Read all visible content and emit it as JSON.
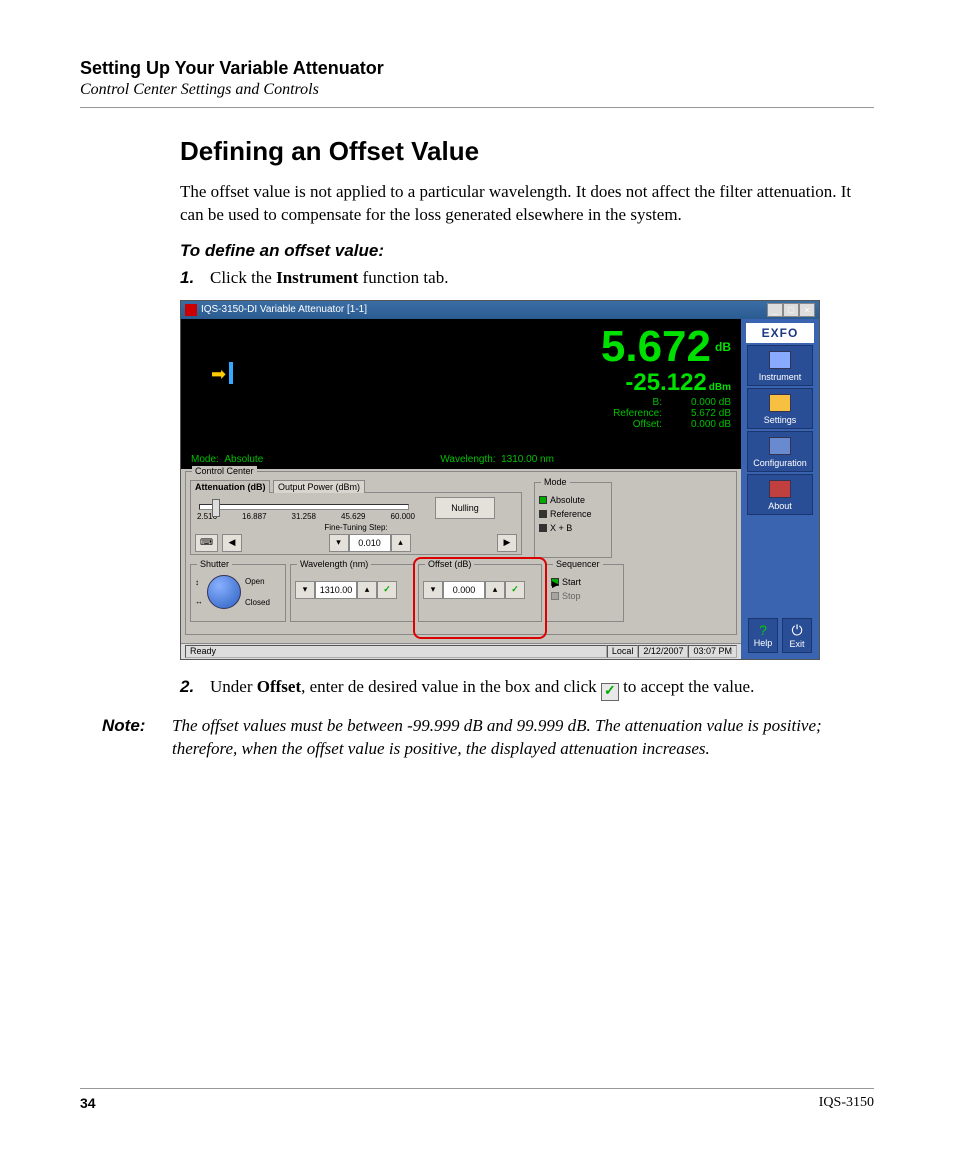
{
  "header": {
    "chapter": "Setting Up Your Variable Attenuator",
    "section": "Control Center Settings and Controls"
  },
  "title": "Defining an Offset Value",
  "intro": "The offset value is not applied to a particular wavelength. It does not affect the filter attenuation. It can be used to compensate for the loss generated elsewhere in the system.",
  "procedure_heading": "To define an offset value:",
  "steps": {
    "one_num": "1.",
    "one_pre": "Click the ",
    "one_bold": "Instrument",
    "one_post": " function tab.",
    "two_num": "2.",
    "two_pre": "Under ",
    "two_bold": "Offset",
    "two_mid": ", enter de desired value in the box and click ",
    "two_post": " to accept the value."
  },
  "note": {
    "label": "Note:",
    "body": "The offset values must be between -99.999 dB and 99.999 dB. The attenuation value is positive; therefore, when the offset value is positive, the displayed attenuation increases."
  },
  "footer": {
    "page": "34",
    "doc": "IQS-3150"
  },
  "screenshot": {
    "window_title": "IQS-3150-DI Variable Attenuator [1-1]",
    "logo": "EXFO",
    "display": {
      "main_value": "5.672",
      "main_unit": "dB",
      "sub_value": "-25.122",
      "sub_unit": "dBm",
      "rows": [
        {
          "k": "B:",
          "v": "0.000 dB"
        },
        {
          "k": "Reference:",
          "v": "5.672 dB"
        },
        {
          "k": "Offset:",
          "v": "0.000 dB"
        }
      ],
      "mode_label": "Mode:",
      "mode_value": "Absolute",
      "wl_label": "Wavelength:",
      "wl_value": "1310.00 nm"
    },
    "control_center": {
      "title": "Control Center",
      "tabs": {
        "att": "Attenuation (dB)",
        "out": "Output Power (dBm)"
      },
      "ticks": [
        "2.516",
        "16.887",
        "31.258",
        "45.629",
        "60.000"
      ],
      "fine_label": "Fine-Tuning Step:",
      "fine_value": "0.010",
      "nulling": "Nulling",
      "mode": {
        "title": "Mode",
        "absolute": "Absolute",
        "reference": "Reference",
        "xb": "X + B"
      },
      "shutter": {
        "title": "Shutter",
        "open": "Open",
        "closed": "Closed"
      },
      "wavelength": {
        "title": "Wavelength (nm)",
        "value": "1310.00"
      },
      "offset": {
        "title": "Offset (dB)",
        "value": "0.000"
      },
      "sequencer": {
        "title": "Sequencer",
        "start": "Start",
        "stop": "Stop"
      }
    },
    "sidebar": {
      "instrument": "Instrument",
      "settings": "Settings",
      "configuration": "Configuration",
      "about": "About",
      "help": "Help",
      "exit": "Exit"
    },
    "status": {
      "ready": "Ready",
      "local": "Local",
      "date": "2/12/2007",
      "time": "03:07 PM"
    }
  }
}
